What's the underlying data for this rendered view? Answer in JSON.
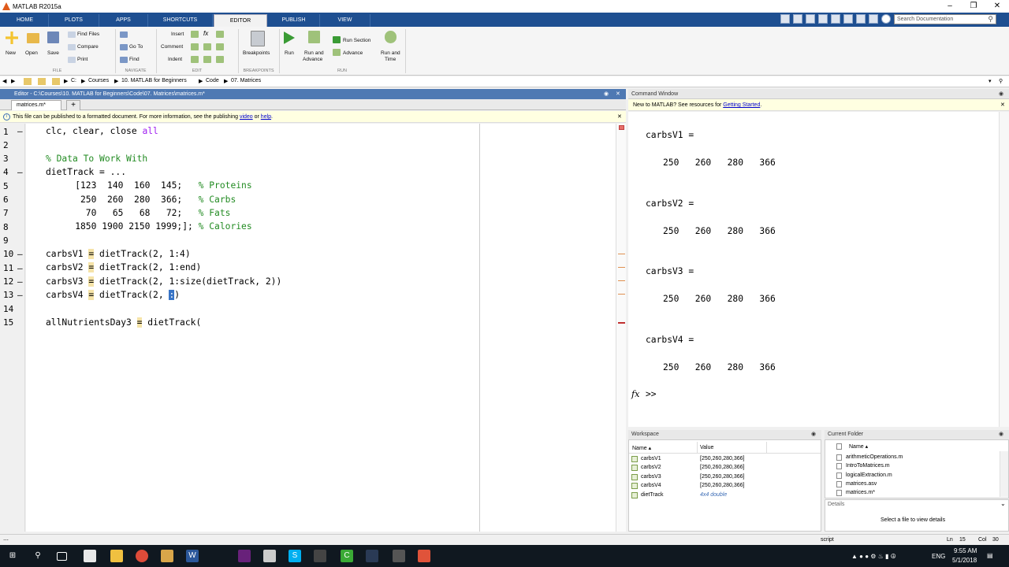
{
  "app": {
    "title": "MATLAB R2015a"
  },
  "ribbon": {
    "tabs": [
      "HOME",
      "PLOTS",
      "APPS",
      "SHORTCUTS",
      "EDITOR",
      "PUBLISH",
      "VIEW"
    ],
    "search_placeholder": "Search Documentation",
    "file": {
      "new": "New",
      "open": "Open",
      "save": "Save",
      "find_files": "Find Files",
      "compare": "Compare",
      "print": "Print",
      "group": "FILE"
    },
    "navigate": {
      "go_to": "Go To",
      "find": "Find",
      "group": "NAVIGATE"
    },
    "edit": {
      "insert": "Insert",
      "comment": "Comment",
      "indent": "Indent",
      "group": "EDIT"
    },
    "breakpoints": {
      "label": "Breakpoints",
      "group": "BREAKPOINTS"
    },
    "run": {
      "run": "Run",
      "run_and_advance_1": "Run and",
      "run_and_advance_2": "Advance",
      "run_section": "Run Section",
      "advance": "Advance",
      "run_and_time_1": "Run and",
      "run_and_time_2": "Time",
      "group": "RUN"
    }
  },
  "address": [
    "C:",
    "Courses",
    "10. MATLAB for Beginners",
    "Code",
    "07. Matrices"
  ],
  "editor": {
    "title": "Editor - C:\\Courses\\10. MATLAB for Beginners\\Code\\07. Matrices\\matrices.m*",
    "tab": "matrices.m*",
    "add_tab": "+",
    "notice_pre": "This file can be published to a formatted document. For more information, see the publishing ",
    "notice_video": "video",
    "notice_or": " or ",
    "notice_help": "help",
    "notice_end": ".",
    "line_numbers": [
      "1",
      "2",
      "3",
      "4",
      "5",
      "6",
      "7",
      "8",
      "9",
      "10",
      "11",
      "12",
      "13",
      "14",
      "15"
    ],
    "lines": {
      "l1a": "clc, clear, close ",
      "l1b": "all",
      "l3": "% Data To Work With",
      "l4": "dietTrack = ...",
      "l5a": "    [123  140  160  145;   ",
      "l5b": "% Proteins",
      "l6a": "     250  260  280  366;   ",
      "l6b": "% Carbs",
      "l7a": "      70   65   68   72;   ",
      "l7b": "% Fats",
      "l8a": "    1850 1900 2150 1999;]; ",
      "l8b": "% Calories",
      "l10a": "carbsV1 ",
      "l10b": "=",
      "l10c": " dietTrack(2, 1:4)",
      "l11a": "carbsV2 ",
      "l11b": "=",
      "l11c": " dietTrack(2, 1:end)",
      "l12a": "carbsV3 ",
      "l12b": "=",
      "l12c": " dietTrack(2, 1:size(dietTrack, 2))",
      "l13a": "carbsV4 ",
      "l13b": "=",
      "l13c": " dietTrack(2, ",
      "l13d": ":",
      "l13e": ")",
      "l15a": "allNutrientsDay3 ",
      "l15b": "=",
      "l15c": " dietTrack("
    }
  },
  "command_window": {
    "title": "Command Window",
    "notice_pre": "New to MATLAB? See resources for ",
    "notice_link": "Getting Started",
    "notice_end": ".",
    "outputs": [
      {
        "name": "carbsV1 =",
        "values": "250   260   280   366"
      },
      {
        "name": "carbsV2 =",
        "values": "250   260   280   366"
      },
      {
        "name": "carbsV3 =",
        "values": "250   260   280   366"
      },
      {
        "name": "carbsV4 =",
        "values": "250   260   280   366"
      }
    ],
    "prompt": ">>",
    "fx": "fx"
  },
  "workspace": {
    "title": "Workspace",
    "col_name": "Name ▴",
    "col_value": "Value",
    "rows": [
      {
        "name": "carbsV1",
        "value": "[250,260,280,366]"
      },
      {
        "name": "carbsV2",
        "value": "[250,260,280,366]"
      },
      {
        "name": "carbsV3",
        "value": "[250,260,280,366]"
      },
      {
        "name": "carbsV4",
        "value": "[250,260,280,366]"
      },
      {
        "name": "dietTrack",
        "value": "4x4 double"
      }
    ]
  },
  "current_folder": {
    "title": "Current Folder",
    "col_name": "Name ▴",
    "files": [
      "arithmeticOperations.m",
      "IntroToMatrices.m",
      "logicalExtraction.m",
      "matrices.asv",
      "matrices.m*"
    ],
    "details_label": "Details",
    "details_text": "Select a file to view details"
  },
  "status": {
    "mode": "script",
    "ln_label": "Ln",
    "ln": "15",
    "col_label": "Col",
    "col": "30"
  },
  "taskbar": {
    "lang": "ENG",
    "time": "9:55 AM",
    "date": "5/1/2018"
  },
  "colors": {
    "ribbon_blue": "#1e4f91",
    "editor_title": "#4f79b3",
    "keyword": "#a020f0",
    "comment": "#228b22"
  }
}
